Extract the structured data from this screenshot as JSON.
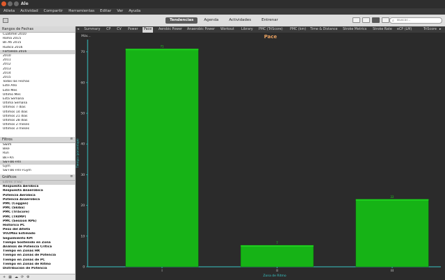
{
  "app": {
    "title": "Ale"
  },
  "menu": [
    "Atleta",
    "Actividad",
    "Compartir",
    "Herramientas",
    "Editar",
    "Ver",
    "Ayuda"
  ],
  "views": [
    {
      "label": "Tendencias",
      "active": true
    },
    {
      "label": "Agenda",
      "active": false
    },
    {
      "label": "Actividades",
      "active": false
    },
    {
      "label": "Entrenar",
      "active": false
    }
  ],
  "search": {
    "placeholder": "Buscar..."
  },
  "sidebar": {
    "dates": {
      "title": "Rangos de Fechas",
      "items": [
        "Cuatimel 2010",
        "Roma 2015",
        "Bli Ati 2015",
        "Rudico 2016",
        "Fortaleza 2016",
        "2010",
        "2011",
        "2012",
        "2013",
        "2014",
        "2015",
        "Todas las Fechas",
        "Este Año",
        "Este Mes",
        "Último Mes",
        "Esta Semana",
        "Última Semana",
        "Últimos 7 días",
        "Últimos 14 días",
        "Últimos 21 días",
        "Últimos 28 días",
        "Últimos 2 meses",
        "Últimos 3 meses"
      ],
      "selected": 4
    },
    "filters": {
      "title": "Filtros",
      "items": [
        "Swim",
        "Bike",
        "Run",
        "Bk+Rn",
        "Sw+Bk+Rn",
        "Gym",
        "Sw+Bk+Rn+Gym"
      ],
      "selected": 4
    },
    "charts": {
      "title": "Gráficos",
      "items": [
        "Estrés (TSS)",
        "Respuesta Aeróbica",
        "Respuesta Anaeróbica",
        "Potencia Aeróbica",
        "Potencia Anaeróbica",
        "PMC (Coggan)",
        "PMC (Skiba)",
        "PMC (TriScore)",
        "PMC (TRIMP)",
        "PMC (Session RPE)",
        "Histórico PC",
        "Peso del Atleta",
        "VO2Máx Estimado",
        "Seguimiento KPI",
        "Tiempo Sostenido en Zona",
        "Análisis de Potencia Crítica",
        "Tiempo en Zonas HR",
        "Tiempo en Zonas de Potencia",
        "Tiempo en Zonas de PC",
        "Tiempo en Zonas de Ritmo",
        "Distribución de Potencia"
      ],
      "selected": 0
    }
  },
  "tabs": [
    "Summary",
    "CP",
    "CV",
    "Power",
    "Pace",
    "Aerobic Power",
    "Anaerobic Power",
    "Workout",
    "Library",
    "PMC (TriScore)",
    "PMC (km)",
    "Time & Distance",
    "Stroke Metrics",
    "Stroke Rate",
    "eCP (LM)",
    "TriScore"
  ],
  "active_tab": "Pace",
  "main": {
    "more_label": "Más..."
  },
  "colors": {
    "bar_fill": "#16b316",
    "bar_top": "#1fd01f",
    "axis": "#37c6c6",
    "title": "#e8a060",
    "accent": "#5a5a5a"
  },
  "chart_data": {
    "type": "bar",
    "title": "Pace",
    "xlabel": "Zona de Ritmo",
    "ylabel": "Tiempo (porcentaje)",
    "categories": [
      "I",
      "II",
      "III"
    ],
    "values": [
      71,
      7,
      22
    ],
    "value_labels": [
      "71",
      "7",
      "22"
    ],
    "yticks": [
      0,
      10,
      20,
      30,
      40,
      50,
      60,
      70
    ],
    "ylim": [
      0,
      74
    ],
    "grid": false,
    "legend": "none"
  }
}
